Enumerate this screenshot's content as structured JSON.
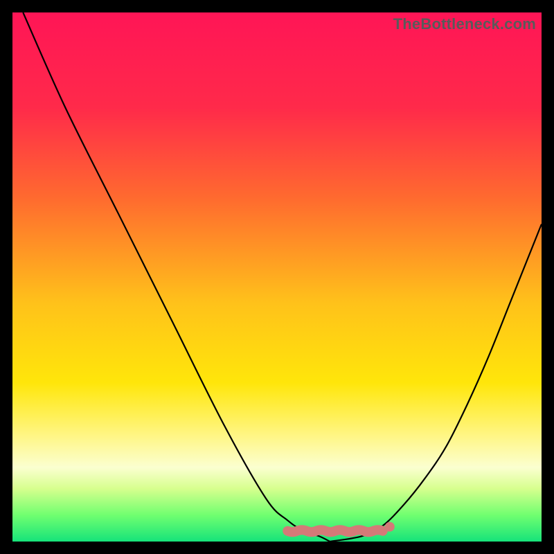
{
  "watermark": "TheBottleneck.com",
  "chart_data": {
    "type": "line",
    "title": "",
    "xlabel": "",
    "ylabel": "",
    "xlim": [
      0,
      100
    ],
    "ylim": [
      0,
      100
    ],
    "gradient_stops": [
      {
        "offset": 0,
        "color": "#ff1556"
      },
      {
        "offset": 18,
        "color": "#ff2a4a"
      },
      {
        "offset": 35,
        "color": "#ff6a2f"
      },
      {
        "offset": 55,
        "color": "#ffc21a"
      },
      {
        "offset": 70,
        "color": "#ffe60a"
      },
      {
        "offset": 80,
        "color": "#fff685"
      },
      {
        "offset": 86,
        "color": "#fbffd0"
      },
      {
        "offset": 90,
        "color": "#d7ff8e"
      },
      {
        "offset": 95,
        "color": "#70ff70"
      },
      {
        "offset": 100,
        "color": "#16e37a"
      }
    ],
    "series": [
      {
        "name": "bottleneck-curve-left",
        "x": [
          2,
          10,
          20,
          30,
          40,
          48,
          52,
          55,
          58,
          60
        ],
        "y": [
          100,
          82,
          62,
          42,
          22,
          8,
          4,
          2,
          1,
          0
        ]
      },
      {
        "name": "bottleneck-curve-right",
        "x": [
          60,
          66,
          70,
          74,
          78,
          82,
          86,
          90,
          94,
          98,
          100
        ],
        "y": [
          0,
          1,
          3,
          7,
          12,
          18,
          26,
          35,
          45,
          55,
          60
        ]
      }
    ],
    "highlight_band": {
      "name": "optimal-range",
      "x_range": [
        52,
        70
      ],
      "y": 2,
      "color": "#d47a78"
    }
  }
}
